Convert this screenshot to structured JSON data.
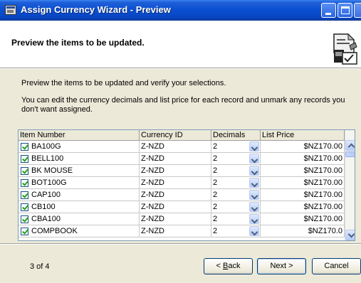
{
  "window": {
    "title": "Assign Currency Wizard - Preview"
  },
  "header": {
    "title": "Preview the items to be updated."
  },
  "instructions": {
    "line1": "Preview the items to be updated and verify your selections.",
    "line2": "You can edit the currency decimals and list price for each record and unmark any records you don't want assigned."
  },
  "grid": {
    "columns": [
      "Item Number",
      "Currency ID",
      "Decimals",
      "List Price"
    ],
    "rows": [
      {
        "checked": true,
        "item": "BA100G",
        "currency": "Z-NZD",
        "decimals": "2",
        "price": "$NZ170.00"
      },
      {
        "checked": true,
        "item": "BELL100",
        "currency": "Z-NZD",
        "decimals": "2",
        "price": "$NZ170.00"
      },
      {
        "checked": true,
        "item": "BK MOUSE",
        "currency": "Z-NZD",
        "decimals": "2",
        "price": "$NZ170.00"
      },
      {
        "checked": true,
        "item": "BOT100G",
        "currency": "Z-NZD",
        "decimals": "2",
        "price": "$NZ170.00"
      },
      {
        "checked": true,
        "item": "CAP100",
        "currency": "Z-NZD",
        "decimals": "2",
        "price": "$NZ170.00"
      },
      {
        "checked": true,
        "item": "CB100",
        "currency": "Z-NZD",
        "decimals": "2",
        "price": "$NZ170.00"
      },
      {
        "checked": true,
        "item": "CBA100",
        "currency": "Z-NZD",
        "decimals": "2",
        "price": "$NZ170.00"
      },
      {
        "checked": true,
        "item": "COMPBOOK",
        "currency": "Z-NZD",
        "decimals": "2",
        "price": "$NZ170.0"
      }
    ]
  },
  "footer": {
    "page": "3 of 4",
    "back_prefix": "< ",
    "back_mnemonic": "B",
    "back_rest": "ack",
    "next": "Next >",
    "cancel": "Cancel"
  },
  "colors": {
    "titlebar": "#0a4fd0",
    "dialog_bg": "#ece9d8",
    "check": "#21a121"
  }
}
